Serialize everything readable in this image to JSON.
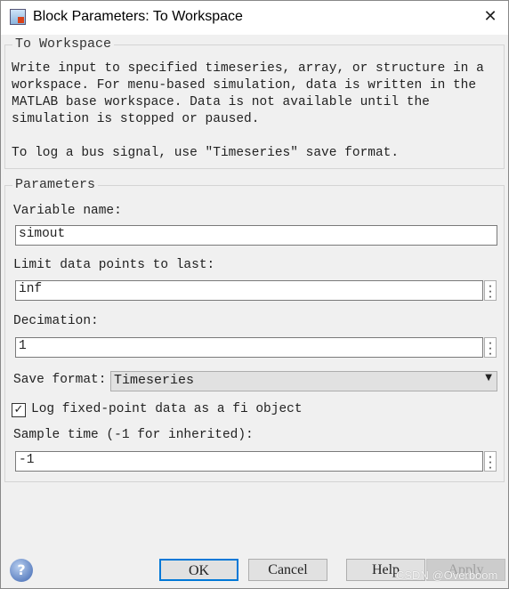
{
  "window": {
    "title": "Block Parameters: To Workspace",
    "close_icon": "close-icon"
  },
  "description": {
    "group_title": "To Workspace",
    "lines": [
      "Write input to specified timeseries, array, or structure in a",
      "workspace. For menu-based simulation, data is written in the",
      "MATLAB base workspace. Data is not available until the",
      "simulation is stopped or paused.",
      "",
      "To log a bus signal, use \"Timeseries\" save format."
    ]
  },
  "parameters": {
    "group_title": "Parameters",
    "variable_name": {
      "label": "Variable name:",
      "value": "simout"
    },
    "limit": {
      "label": "Limit data points to last:",
      "value": "inf"
    },
    "decimation": {
      "label": "Decimation:",
      "value": "1"
    },
    "save_format": {
      "label": "Save format:",
      "value": "Timeseries"
    },
    "log_fixed_point": {
      "label": "Log fixed-point data as a fi object",
      "checked": true
    },
    "sample_time": {
      "label": "Sample time (-1 for inherited):",
      "value": "-1"
    }
  },
  "buttons": {
    "ok": "OK",
    "cancel": "Cancel",
    "help": "Help",
    "apply": "Apply"
  },
  "watermark": "CSDN @Overboom"
}
